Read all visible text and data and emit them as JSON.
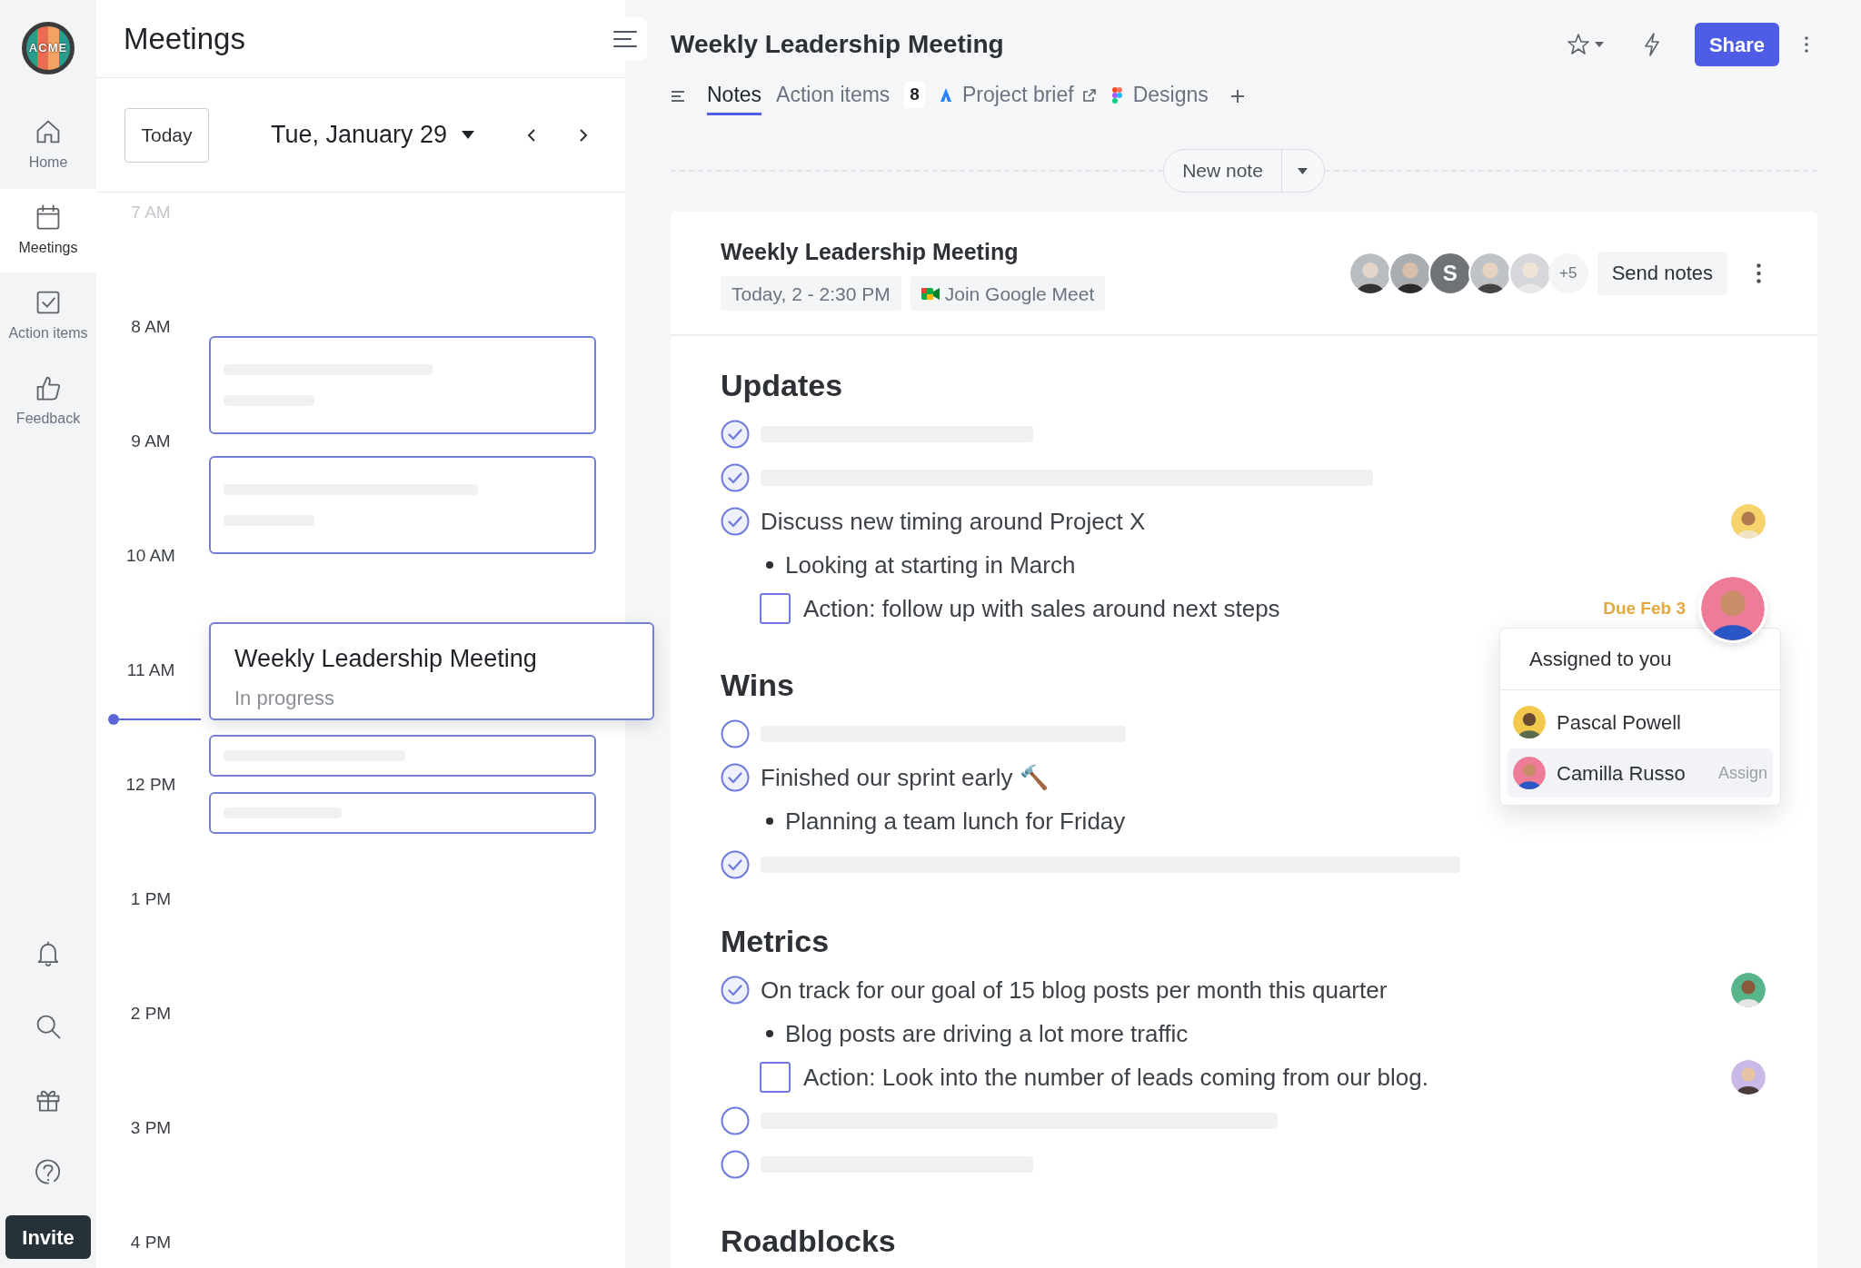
{
  "nav": {
    "logo": "ACME",
    "items": [
      {
        "label": "Home",
        "selected": false
      },
      {
        "label": "Meetings",
        "selected": true
      },
      {
        "label": "Action items",
        "selected": false
      },
      {
        "label": "Feedback",
        "selected": false
      }
    ],
    "invite": "Invite"
  },
  "calendar": {
    "title": "Meetings",
    "today": "Today",
    "date": "Tue, January 29",
    "hours": [
      {
        "label": "7 AM",
        "faded": true
      },
      {
        "label": "8 AM",
        "faded": false
      },
      {
        "label": "9 AM",
        "faded": false
      },
      {
        "label": "10 AM",
        "faded": false
      },
      {
        "label": "11 AM",
        "faded": false
      },
      {
        "label": "12 PM",
        "faded": false
      },
      {
        "label": "1 PM",
        "faded": false
      },
      {
        "label": "2 PM",
        "faded": false
      },
      {
        "label": "3 PM",
        "faded": false
      },
      {
        "label": "4 PM",
        "faded": false
      }
    ],
    "events": [
      {
        "kind": "placeholder"
      },
      {
        "kind": "placeholder"
      },
      {
        "kind": "meeting",
        "title": "Weekly Leadership Meeting",
        "status": "In progress"
      },
      {
        "kind": "placeholder"
      },
      {
        "kind": "placeholder"
      }
    ]
  },
  "meeting": {
    "title": "Weekly Leadership Meeting",
    "share": "Share",
    "tabs": [
      {
        "label": "Notes",
        "selected": true
      },
      {
        "label": "Action items",
        "badge": "8",
        "selected": false
      },
      {
        "label": "Project brief",
        "selected": false
      },
      {
        "label": "Designs",
        "selected": false
      }
    ],
    "new_note": "New note"
  },
  "note": {
    "title": "Weekly Leadership Meeting",
    "time": "Today, 2 - 2:30 PM",
    "join": "Join Google Meet",
    "attendees": [
      {
        "kind": "photo"
      },
      {
        "kind": "photo"
      },
      {
        "kind": "initial",
        "text": "S"
      },
      {
        "kind": "photo"
      },
      {
        "kind": "photo"
      }
    ],
    "more": "+5",
    "send": "Send notes",
    "sections": [
      {
        "heading": "Updates",
        "items": [
          {
            "kind": "task",
            "checked": true,
            "avatar": false
          },
          {
            "kind": "task",
            "checked": true,
            "avatar": false
          },
          {
            "kind": "task",
            "checked": true,
            "text": "Discuss new timing around Project X",
            "avatar": true,
            "children": [
              {
                "kind": "bullet",
                "text": "Looking at starting in March"
              },
              {
                "kind": "action",
                "checked": false,
                "text": "Action: follow up with sales around next steps",
                "due": "Due Feb 3",
                "menu": {
                  "title": "Assigned to you",
                  "people": [
                    {
                      "name": "Pascal Powell",
                      "selected": false
                    },
                    {
                      "name": "Camilla Russo",
                      "selected": true,
                      "action": "Assign"
                    }
                  ]
                }
              }
            ]
          }
        ]
      },
      {
        "heading": "Wins",
        "items": [
          {
            "kind": "task",
            "checked": false,
            "avatar": false
          },
          {
            "kind": "task",
            "checked": true,
            "text": "Finished our sprint early 🔨",
            "avatar": false,
            "children": [
              {
                "kind": "bullet",
                "text": "Planning a team lunch for Friday"
              }
            ]
          },
          {
            "kind": "task",
            "checked": true,
            "avatar": false
          }
        ]
      },
      {
        "heading": "Metrics",
        "items": [
          {
            "kind": "task",
            "checked": true,
            "text": "On track for our goal of 15 blog posts per month this quarter",
            "avatar": true,
            "children": [
              {
                "kind": "bullet",
                "text": "Blog posts are driving a lot more traffic"
              },
              {
                "kind": "action",
                "checked": false,
                "text": "Action: Look into the number of leads coming from our blog.",
                "avatar": true
              }
            ]
          },
          {
            "kind": "task",
            "checked": false,
            "avatar": false
          },
          {
            "kind": "task",
            "checked": false,
            "avatar": false
          }
        ]
      },
      {
        "heading": "Roadblocks"
      }
    ]
  }
}
